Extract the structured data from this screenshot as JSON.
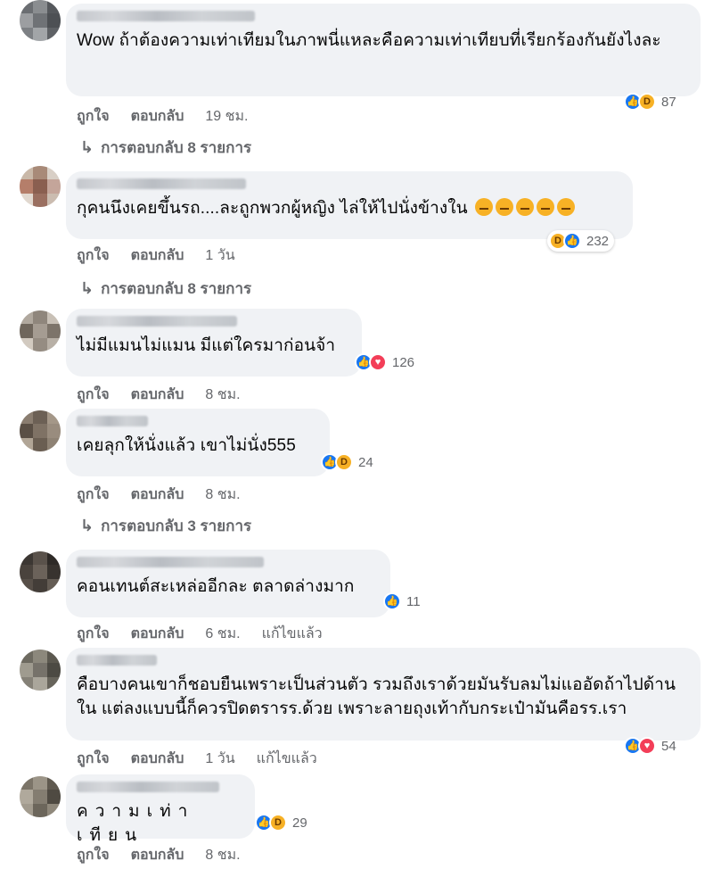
{
  "labels": {
    "like": "ถูกใจ",
    "reply": "ตอบกลับ",
    "edited": "แก้ไขแล้ว"
  },
  "comments": [
    {
      "text": "Wow ถ้าต้องความเท่าเทียมในภาพนี่แหละคือความเท่าเทียบที่เรียกร้องกันยังไงละ",
      "reactions": [
        "like-icon",
        "haha-icon"
      ],
      "reaction_count": "87",
      "time": "19 ชม.",
      "replies": "การตอบกลับ 8 รายการ"
    },
    {
      "text": "กุคนนึงเคยขึ้นรถ....ละถูกพวกผู้หญิง ไล่ให้ไปนั่งข้างใน",
      "reactions": [
        "haha-icon",
        "like-icon"
      ],
      "reaction_count": "232",
      "time": "1 วัน",
      "replies": "การตอบกลับ 8 รายการ"
    },
    {
      "text": "ไม่มีแมนไม่แมน มีแต่ใครมาก่อนจ้า",
      "reactions": [
        "like-icon",
        "love-icon"
      ],
      "reaction_count": "126",
      "time": "8 ชม."
    },
    {
      "text": "เคยลุกให้นั่งแล้ว เขาไม่นั่ง555",
      "reactions": [
        "like-icon",
        "haha-icon"
      ],
      "reaction_count": "24",
      "time": "8 ชม.",
      "replies": "การตอบกลับ 3 รายการ"
    },
    {
      "text": "คอนเทนต์สะเหล่ออีกละ ตลาดล่างมาก",
      "reactions": [
        "like-icon"
      ],
      "reaction_count": "11",
      "time": "6 ชม.",
      "edited": true
    },
    {
      "text": "คือบางคนเขาก็ชอบยืนเพราะเป็นส่วนตัว รวมถึงเราด้วยมันรับลมไม่แออัดถ้าไปด้านใน แต่ลงแบบนี้ก็ควรปิดตรารร.ด้วย เพราะลายถุงเท้ากับกระเป๋ามันคือรร.เรา",
      "reactions": [
        "like-icon",
        "love-icon"
      ],
      "reaction_count": "54",
      "time": "1 วัน",
      "edited": true
    },
    {
      "text": "ความเท่าเทียน",
      "reactions": [
        "like-icon",
        "haha-icon"
      ],
      "reaction_count": "29",
      "time": "8 ชม."
    }
  ],
  "colors": {
    "bubble": "#f0f2f5",
    "meta_text": "#65676b",
    "like": "#1877f2",
    "haha": "#f7b125",
    "love": "#f33e58"
  }
}
